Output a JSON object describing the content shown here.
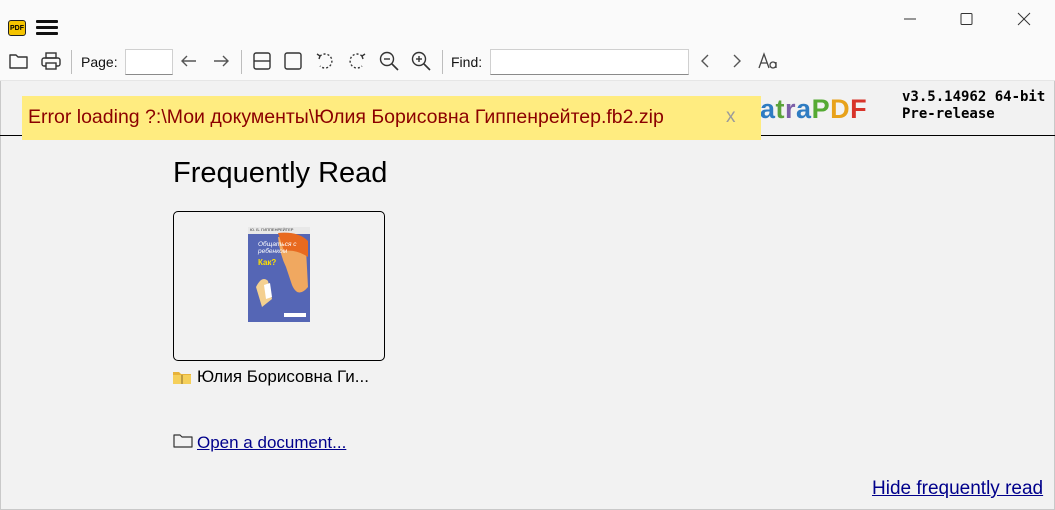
{
  "titlebar": {
    "app_icon_label": "PDF",
    "menu_icon": "hamburger-menu-icon"
  },
  "toolbar": {
    "page_label": "Page:",
    "page_value": "",
    "find_label": "Find:",
    "find_value": "",
    "icons": [
      "open-folder-icon",
      "print-icon",
      "back-arrow-icon",
      "forward-arrow-icon",
      "single-page-icon",
      "fit-page-icon",
      "rotate-left-icon",
      "rotate-right-icon",
      "zoom-out-icon",
      "zoom-in-icon",
      "find-prev-icon",
      "find-next-icon",
      "match-case-icon"
    ]
  },
  "header": {
    "logo_visible": "atraPDF",
    "logo_parts": [
      {
        "text": "a",
        "color": "#2f7cc2"
      },
      {
        "text": "t",
        "color": "#5ba33b"
      },
      {
        "text": "r",
        "color": "#7c5fa8"
      },
      {
        "text": "a",
        "color": "#2f7cc2"
      },
      {
        "text": "P",
        "color": "#55aa33"
      },
      {
        "text": "D",
        "color": "#e8a21a"
      },
      {
        "text": "F",
        "color": "#d8342a"
      }
    ],
    "version_line1": "v3.5.14962 64-bit",
    "version_line2": "Pre-release"
  },
  "error": {
    "message": "Error loading ?:\\Мои документы\\Юлия Борисовна Гиппенрейтер.fb2.zip",
    "close": "x",
    "bg_color": "#ffec80",
    "text_color": "#8b0000"
  },
  "main": {
    "section_title": "Frequently Read",
    "documents": [
      {
        "label": "Юлия Борисовна Ги...",
        "cover_top": "Ю. Б. ГИППЕНРЕЙТЕР",
        "cover_title": "Общаться с ребенком",
        "cover_subtitle": "Как?"
      }
    ],
    "open_document": "Open a document...",
    "hide_frequently_read": "Hide frequently read"
  }
}
